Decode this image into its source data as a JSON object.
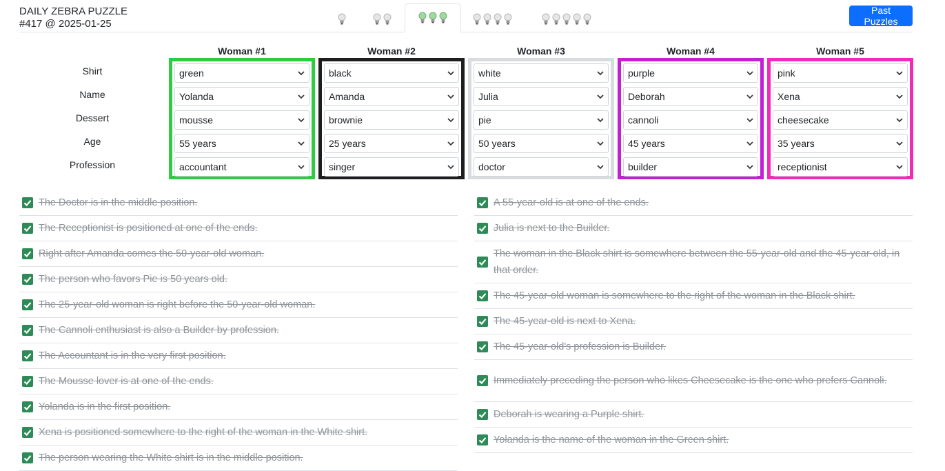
{
  "header": {
    "title_line1": "DAILY ZEBRA PUZZLE",
    "title_line2": "#417 @ 2025-01-25",
    "past_button": "Past Puzzles"
  },
  "difficulty_tabs": [
    {
      "bulbs": 1,
      "active": false
    },
    {
      "bulbs": 2,
      "active": false
    },
    {
      "bulbs": 3,
      "active": true
    },
    {
      "bulbs": 4,
      "active": false
    },
    {
      "bulbs": 5,
      "active": false
    }
  ],
  "row_labels": [
    "Shirt",
    "Name",
    "Dessert",
    "Age",
    "Profession"
  ],
  "columns": [
    {
      "header": "Woman #1",
      "border_color": "#2ecc40",
      "values": [
        "green",
        "Yolanda",
        "mousse",
        "55 years",
        "accountant"
      ]
    },
    {
      "header": "Woman #2",
      "border_color": "#1e1e1e",
      "values": [
        "black",
        "Amanda",
        "brownie",
        "25 years",
        "singer"
      ]
    },
    {
      "header": "Woman #3",
      "border_color": "#d9dcdf",
      "values": [
        "white",
        "Julia",
        "pie",
        "50 years",
        "doctor"
      ]
    },
    {
      "header": "Woman #4",
      "border_color": "#c41fd4",
      "values": [
        "purple",
        "Deborah",
        "cannoli",
        "45 years",
        "builder"
      ]
    },
    {
      "header": "Woman #5",
      "border_color": "#f02bb8",
      "values": [
        "pink",
        "Xena",
        "cheesecake",
        "35 years",
        "receptionist"
      ]
    }
  ],
  "clues_left": [
    "The Doctor is in the middle position.",
    "The Receptionist is positioned at one of the ends.",
    "Right after Amanda comes the 50-year-old woman.",
    "The person who favors Pie is 50 years old.",
    "The 25-year-old woman is right before the 50-year-old woman.",
    "The Cannoli enthusiast is also a Builder by profession.",
    "The Accountant is in the very first position.",
    "The Mousse lover is at one of the ends.",
    "Yolanda is in the first position.",
    "Xena is positioned somewhere to the right of the woman in the White shirt.",
    "The person wearing the White shirt is in the middle position."
  ],
  "clues_right": [
    "A 55-year-old is at one of the ends.",
    "Julia is next to the Builder.",
    "The woman in the Black shirt is somewhere between the 55-year-old and the 45-year-old, in that order.",
    "The 45-year-old woman is somewhere to the right of the woman in the Black shirt.",
    "The 45-year-old is next to Xena.",
    "The 45-year-old's profession is Builder.",
    "Immediately preceding the person who likes Cheesecake is the one who prefers Cannoli.",
    "Deborah is wearing a Purple shirt.",
    "Yolanda is the name of the woman in the Green shirt."
  ],
  "colors": {
    "accent": "#0d6efd",
    "check": "#2e8b57",
    "clue_text": "#8f959a"
  }
}
